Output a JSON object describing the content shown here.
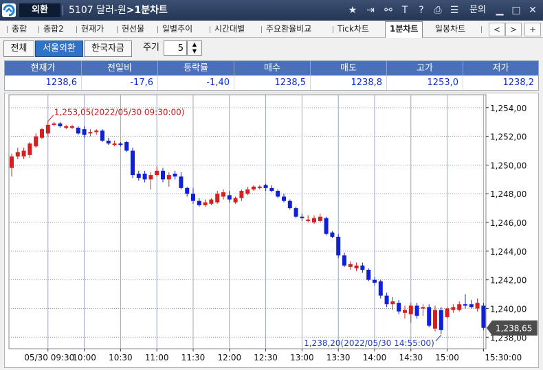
{
  "window": {
    "app_name": "외환",
    "title_code": "5107 달러-원",
    "title_sep": ">",
    "title_screen": "1분차트",
    "menu_label": "문의",
    "icons": [
      "star-icon",
      "export-icon",
      "link-icon",
      "text-icon",
      "help-icon",
      "print-icon",
      "list-icon",
      "minimize-icon",
      "maximize-icon",
      "close-icon"
    ]
  },
  "tabs": [
    {
      "label": "종합"
    },
    {
      "label": "종합2"
    },
    {
      "label": "현재가"
    },
    {
      "label": "현선물"
    },
    {
      "label": "일별추이"
    },
    {
      "label": "시간대별"
    },
    {
      "label": "주요환율비교"
    },
    {
      "label": "Tick차트"
    },
    {
      "label": "1분차트",
      "active": true
    },
    {
      "label": "일봉차트"
    }
  ],
  "tab_nav": {
    "prev": "<",
    "next": ">",
    "add": "+"
  },
  "options": {
    "market_buttons": [
      {
        "label": "전체",
        "selected": false
      },
      {
        "label": "서울외환",
        "selected": true
      },
      {
        "label": "한국자금",
        "selected": false
      }
    ],
    "period_label": "주기",
    "period_value": "5"
  },
  "quote": {
    "headers": [
      "현재가",
      "전일비",
      "등락률",
      "매수",
      "매도",
      "고가",
      "저가"
    ],
    "values": [
      "1238,6",
      "-17,6",
      "-1,40",
      "1238,5",
      "1238,8",
      "1253,0",
      "1238,2"
    ]
  },
  "colors": {
    "up": "#d42020",
    "down": "#1020d8",
    "header_bg": "#4a71b8"
  },
  "chart_data": {
    "type": "candlestick",
    "interval_minutes": 5,
    "ylim": [
      1237.2,
      1254.9
    ],
    "y_ticks": [
      "1,254,00",
      "1,252,00",
      "1,250,00",
      "1,248,00",
      "1,246,00",
      "1,244,00",
      "1,242,00",
      "1,240,00",
      "1,238,00"
    ],
    "x_ticks": [
      "05/30 09:30",
      "10:00",
      "10:30",
      "11:00",
      "11:30",
      "12:00",
      "12:30",
      "13:00",
      "13:30",
      "14:00",
      "14:30",
      "15:00",
      "15:30:00"
    ],
    "current_price_label": "1,238,65",
    "current_price": 1238.65,
    "high_annotation": {
      "text": "1,253,05(2022/05/30 09:30:00)",
      "value": 1253.05,
      "time": "09:30"
    },
    "low_annotation": {
      "text": "1,238,20(2022/05/30 14:55:00)",
      "value": 1238.2,
      "time": "14:55"
    },
    "candles": [
      {
        "time": "09:00",
        "o": 1249.8,
        "h": 1250.8,
        "l": 1249.2,
        "c": 1250.6
      },
      {
        "time": "09:05",
        "o": 1250.6,
        "h": 1251.2,
        "l": 1250.4,
        "c": 1250.9
      },
      {
        "time": "09:10",
        "o": 1250.6,
        "h": 1251.2,
        "l": 1250.4,
        "c": 1251.0
      },
      {
        "time": "09:15",
        "o": 1250.7,
        "h": 1251.6,
        "l": 1250.5,
        "c": 1251.5
      },
      {
        "time": "09:20",
        "o": 1251.3,
        "h": 1252.2,
        "l": 1251.2,
        "c": 1252.0
      },
      {
        "time": "09:25",
        "o": 1251.9,
        "h": 1252.6,
        "l": 1251.8,
        "c": 1252.5
      },
      {
        "time": "09:30",
        "o": 1252.2,
        "h": 1253.05,
        "l": 1252.0,
        "c": 1252.8
      },
      {
        "time": "09:35",
        "o": 1252.8,
        "h": 1253.0,
        "l": 1252.7,
        "c": 1252.9
      },
      {
        "time": "09:40",
        "o": 1252.9,
        "h": 1253.0,
        "l": 1252.6,
        "c": 1252.7
      },
      {
        "time": "09:45",
        "o": 1252.6,
        "h": 1252.8,
        "l": 1252.5,
        "c": 1252.7
      },
      {
        "time": "09:50",
        "o": 1252.6,
        "h": 1252.8,
        "l": 1252.5,
        "c": 1252.7
      },
      {
        "time": "09:55",
        "o": 1252.6,
        "h": 1252.7,
        "l": 1252.1,
        "c": 1252.2
      },
      {
        "time": "10:00",
        "o": 1252.5,
        "h": 1252.7,
        "l": 1251.9,
        "c": 1252.1
      },
      {
        "time": "10:05",
        "o": 1252.2,
        "h": 1252.5,
        "l": 1252.0,
        "c": 1252.3
      },
      {
        "time": "10:10",
        "o": 1252.3,
        "h": 1252.5,
        "l": 1252.1,
        "c": 1252.4
      },
      {
        "time": "10:15",
        "o": 1252.4,
        "h": 1252.5,
        "l": 1251.6,
        "c": 1251.7
      },
      {
        "time": "10:20",
        "o": 1251.7,
        "h": 1251.9,
        "l": 1251.4,
        "c": 1251.5
      },
      {
        "time": "10:25",
        "o": 1251.4,
        "h": 1251.7,
        "l": 1251.3,
        "c": 1251.5
      },
      {
        "time": "10:30",
        "o": 1251.5,
        "h": 1251.6,
        "l": 1251.3,
        "c": 1251.4
      },
      {
        "time": "10:35",
        "o": 1251.6,
        "h": 1251.7,
        "l": 1250.9,
        "c": 1251.0
      },
      {
        "time": "10:40",
        "o": 1251.0,
        "h": 1251.2,
        "l": 1249.1,
        "c": 1249.3
      },
      {
        "time": "10:45",
        "o": 1249.4,
        "h": 1249.6,
        "l": 1248.9,
        "c": 1249.1
      },
      {
        "time": "10:50",
        "o": 1249.4,
        "h": 1249.6,
        "l": 1248.8,
        "c": 1249.0
      },
      {
        "time": "10:55",
        "o": 1249.0,
        "h": 1249.5,
        "l": 1248.3,
        "c": 1249.3
      },
      {
        "time": "11:00",
        "o": 1249.3,
        "h": 1249.9,
        "l": 1249.2,
        "c": 1249.6
      },
      {
        "time": "11:05",
        "o": 1249.6,
        "h": 1249.8,
        "l": 1248.8,
        "c": 1249.0
      },
      {
        "time": "11:10",
        "o": 1249.0,
        "h": 1249.5,
        "l": 1248.5,
        "c": 1249.3
      },
      {
        "time": "11:15",
        "o": 1249.4,
        "h": 1249.6,
        "l": 1249.0,
        "c": 1249.2
      },
      {
        "time": "11:20",
        "o": 1249.2,
        "h": 1249.5,
        "l": 1248.3,
        "c": 1248.4
      },
      {
        "time": "11:25",
        "o": 1248.4,
        "h": 1248.5,
        "l": 1247.8,
        "c": 1248.0
      },
      {
        "time": "11:30",
        "o": 1248.0,
        "h": 1248.4,
        "l": 1247.3,
        "c": 1247.5
      },
      {
        "time": "11:35",
        "o": 1247.5,
        "h": 1247.7,
        "l": 1247.1,
        "c": 1247.2
      },
      {
        "time": "11:40",
        "o": 1247.2,
        "h": 1247.6,
        "l": 1247.1,
        "c": 1247.4
      },
      {
        "time": "11:45",
        "o": 1247.3,
        "h": 1247.7,
        "l": 1247.2,
        "c": 1247.6
      },
      {
        "time": "11:50",
        "o": 1247.4,
        "h": 1248.2,
        "l": 1247.3,
        "c": 1248.0
      },
      {
        "time": "11:55",
        "o": 1247.8,
        "h": 1248.3,
        "l": 1247.6,
        "c": 1248.1
      },
      {
        "time": "12:00",
        "o": 1247.9,
        "h": 1248.2,
        "l": 1247.4,
        "c": 1247.6
      },
      {
        "time": "12:05",
        "o": 1247.4,
        "h": 1247.8,
        "l": 1247.3,
        "c": 1247.7
      },
      {
        "time": "12:10",
        "o": 1247.7,
        "h": 1248.3,
        "l": 1247.5,
        "c": 1248.2
      },
      {
        "time": "12:15",
        "o": 1248.0,
        "h": 1248.5,
        "l": 1247.9,
        "c": 1248.3
      },
      {
        "time": "12:20",
        "o": 1248.3,
        "h": 1248.6,
        "l": 1248.2,
        "c": 1248.5
      },
      {
        "time": "12:25",
        "o": 1248.4,
        "h": 1248.6,
        "l": 1248.3,
        "c": 1248.5
      },
      {
        "time": "12:30",
        "o": 1248.6,
        "h": 1248.7,
        "l": 1248.2,
        "c": 1248.4
      },
      {
        "time": "12:35",
        "o": 1248.4,
        "h": 1248.6,
        "l": 1248.1,
        "c": 1248.2
      },
      {
        "time": "12:40",
        "o": 1248.2,
        "h": 1248.3,
        "l": 1247.7,
        "c": 1247.8
      },
      {
        "time": "12:45",
        "o": 1247.8,
        "h": 1248.0,
        "l": 1247.4,
        "c": 1247.5
      },
      {
        "time": "12:50",
        "o": 1247.5,
        "h": 1247.6,
        "l": 1246.9,
        "c": 1247.0
      },
      {
        "time": "12:55",
        "o": 1247.0,
        "h": 1247.1,
        "l": 1246.3,
        "c": 1246.4
      },
      {
        "time": "13:00",
        "o": 1246.4,
        "h": 1246.6,
        "l": 1246.1,
        "c": 1246.3
      },
      {
        "time": "13:05",
        "o": 1246.1,
        "h": 1246.5,
        "l": 1246.0,
        "c": 1246.2
      },
      {
        "time": "13:10",
        "o": 1246.0,
        "h": 1246.5,
        "l": 1245.9,
        "c": 1246.3
      },
      {
        "time": "13:15",
        "o": 1246.1,
        "h": 1246.6,
        "l": 1246.0,
        "c": 1246.4
      },
      {
        "time": "13:20",
        "o": 1246.3,
        "h": 1246.4,
        "l": 1245.1,
        "c": 1245.2
      },
      {
        "time": "13:25",
        "o": 1245.3,
        "h": 1245.4,
        "l": 1244.9,
        "c": 1245.0
      },
      {
        "time": "13:30",
        "o": 1245.0,
        "h": 1245.2,
        "l": 1243.5,
        "c": 1243.7
      },
      {
        "time": "13:35",
        "o": 1243.7,
        "h": 1243.9,
        "l": 1242.9,
        "c": 1243.0
      },
      {
        "time": "13:40",
        "o": 1242.9,
        "h": 1243.3,
        "l": 1242.7,
        "c": 1243.1
      },
      {
        "time": "13:45",
        "o": 1242.8,
        "h": 1243.2,
        "l": 1242.6,
        "c": 1243.0
      },
      {
        "time": "13:50",
        "o": 1243.0,
        "h": 1243.2,
        "l": 1242.5,
        "c": 1242.7
      },
      {
        "time": "13:55",
        "o": 1242.7,
        "h": 1242.8,
        "l": 1241.9,
        "c": 1242.0
      },
      {
        "time": "14:00",
        "o": 1242.0,
        "h": 1242.2,
        "l": 1241.6,
        "c": 1241.8
      },
      {
        "time": "14:05",
        "o": 1241.9,
        "h": 1242.0,
        "l": 1240.7,
        "c": 1240.9
      },
      {
        "time": "14:10",
        "o": 1240.9,
        "h": 1241.1,
        "l": 1240.1,
        "c": 1240.3
      },
      {
        "time": "14:15",
        "o": 1240.3,
        "h": 1240.8,
        "l": 1239.9,
        "c": 1240.5
      },
      {
        "time": "14:20",
        "o": 1240.4,
        "h": 1240.6,
        "l": 1239.6,
        "c": 1239.8
      },
      {
        "time": "14:25",
        "o": 1239.7,
        "h": 1240.2,
        "l": 1239.3,
        "c": 1239.9
      },
      {
        "time": "14:30",
        "o": 1239.6,
        "h": 1240.4,
        "l": 1239.0,
        "c": 1240.2
      },
      {
        "time": "14:35",
        "o": 1240.2,
        "h": 1240.4,
        "l": 1239.3,
        "c": 1239.5
      },
      {
        "time": "14:40",
        "o": 1240.0,
        "h": 1240.3,
        "l": 1239.5,
        "c": 1240.1
      },
      {
        "time": "14:45",
        "o": 1240.1,
        "h": 1240.3,
        "l": 1238.7,
        "c": 1238.8
      },
      {
        "time": "14:50",
        "o": 1238.6,
        "h": 1240.2,
        "l": 1238.4,
        "c": 1239.9
      },
      {
        "time": "14:55",
        "o": 1239.9,
        "h": 1240.1,
        "l": 1238.2,
        "c": 1238.5
      },
      {
        "time": "15:00",
        "o": 1239.4,
        "h": 1240.1,
        "l": 1239.3,
        "c": 1240.0
      },
      {
        "time": "15:05",
        "o": 1239.9,
        "h": 1240.3,
        "l": 1239.7,
        "c": 1240.1
      },
      {
        "time": "15:10",
        "o": 1239.9,
        "h": 1240.5,
        "l": 1239.8,
        "c": 1240.3
      },
      {
        "time": "15:15",
        "o": 1240.3,
        "h": 1241.0,
        "l": 1240.0,
        "c": 1240.2
      },
      {
        "time": "15:20",
        "o": 1240.3,
        "h": 1240.6,
        "l": 1240.0,
        "c": 1240.1
      },
      {
        "time": "15:25",
        "o": 1240.0,
        "h": 1240.7,
        "l": 1239.8,
        "c": 1240.4
      },
      {
        "time": "15:30",
        "o": 1240.2,
        "h": 1240.4,
        "l": 1238.5,
        "c": 1238.65
      }
    ]
  }
}
